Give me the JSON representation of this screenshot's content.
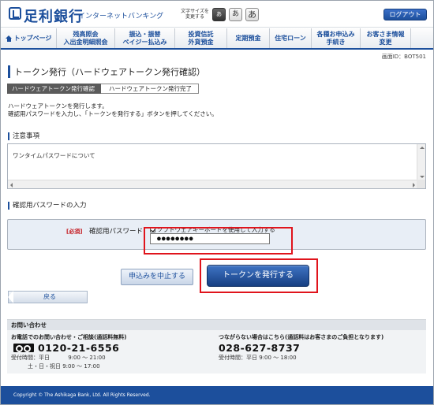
{
  "header": {
    "bank_name": "足利銀行",
    "service_name": "インターネットバンキング",
    "font_size_label": "文字サイズを\n変更する",
    "font_sizes": [
      "あ",
      "あ",
      "あ"
    ],
    "logout_label": "ログアウト"
  },
  "nav": {
    "items": [
      {
        "label": "トップページ"
      },
      {
        "label": "残高照会\n入出金明細照会"
      },
      {
        "label": "振込・振替\nペイジー払込み"
      },
      {
        "label": "投資信託\n外貨預金"
      },
      {
        "label": "定期預金"
      },
      {
        "label": "住宅ローン"
      },
      {
        "label": "各種お申込み\n手続き"
      },
      {
        "label": "お客さま情報\n変更"
      }
    ]
  },
  "screen_id": "画面ID：BOT501",
  "page_title": "トークン発行（ハードウェアトークン発行確認）",
  "steps": {
    "current": "ハードウェアトークン発行確認",
    "next": "ハードウェアトークン発行完了"
  },
  "description": {
    "line1": "ハードウェアトークンを発行します。",
    "line2": "確認用パスワードを入力し、「トークンを発行する」ボタンを押してください。"
  },
  "notice": {
    "heading": "注意事項",
    "text": "ワンタイムパスワードについて"
  },
  "password_section": {
    "heading": "確認用パスワードの入力",
    "required_label": "[必須]",
    "field_label": "確認用パスワード",
    "software_keyboard_label": "ソフトウェアキーボードを使用して入力する",
    "software_keyboard_checked": true,
    "value": "●●●●●●●●"
  },
  "buttons": {
    "cancel": "申込みを中止する",
    "issue": "トークンを発行する",
    "back": "戻る"
  },
  "contact": {
    "heading": "お問い合わせ",
    "left_sub": "お電話でのお問い合わせ・ご相談(通話料無料)",
    "left_phone": "0120-21-6556",
    "left_hours1": "受付時間：平日　　　 9:00 ～ 21:00",
    "left_hours2": "　　　土・日・祝日 9:00 ～ 17:00",
    "right_sub": "つながらない場合はこちら(通話料はお客さまのご負担となります)",
    "right_phone": "028-627-8737",
    "right_hours": "受付時間：平日 9:00 ～ 18:00"
  },
  "footer": {
    "copyright": "Copyright © The Ashikaga Bank, Ltd. All Rights Reserved."
  },
  "colors": {
    "brand": "#1c4f9c",
    "highlight": "#e0141c",
    "required": "#c4161c"
  }
}
